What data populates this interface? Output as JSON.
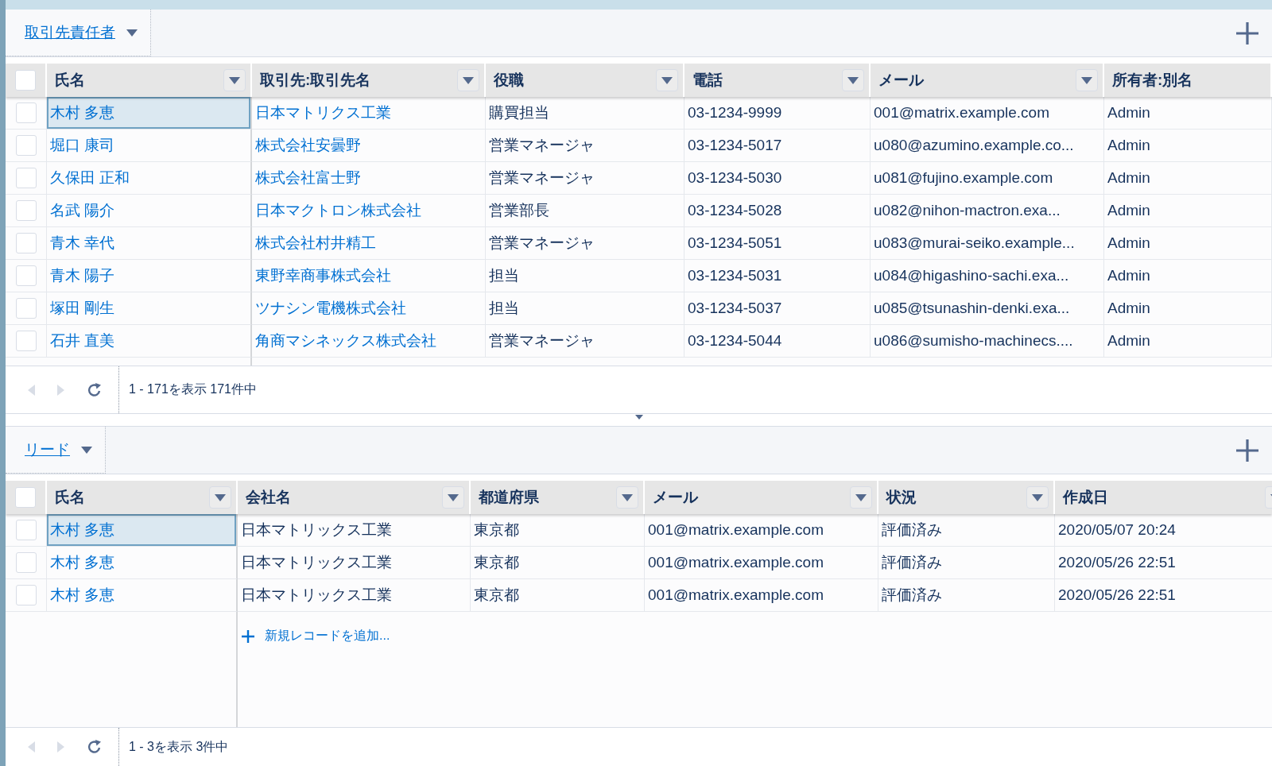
{
  "panels": [
    {
      "tab": {
        "label": "取引先責任者"
      },
      "header_checkbox": {
        "checked": false
      },
      "columns": [
        {
          "label": "氏名",
          "kind": "link",
          "menu": true
        },
        {
          "label": "取引先:取引先名",
          "kind": "link",
          "menu": true
        },
        {
          "label": "役職",
          "kind": "text",
          "menu": true
        },
        {
          "label": "電話",
          "kind": "text",
          "menu": true
        },
        {
          "label": "メール",
          "kind": "text",
          "menu": true
        },
        {
          "label": "所有者:別名",
          "kind": "text",
          "menu": false
        }
      ],
      "rows": [
        {
          "checked": false,
          "selected": true,
          "cells": [
            "木村 多恵",
            "日本マトリクス工業",
            "購買担当",
            "03-1234-9999",
            "001@matrix.example.com",
            "Admin"
          ]
        },
        {
          "checked": false,
          "selected": false,
          "cells": [
            "堀口 康司",
            "株式会社安曇野",
            "営業マネージャ",
            "03-1234-5017",
            "u080@azumino.example.co...",
            "Admin"
          ]
        },
        {
          "checked": false,
          "selected": false,
          "cells": [
            "久保田 正和",
            "株式会社富士野",
            "営業マネージャ",
            "03-1234-5030",
            "u081@fujino.example.com",
            "Admin"
          ]
        },
        {
          "checked": false,
          "selected": false,
          "cells": [
            "名武 陽介",
            "日本マクトロン株式会社",
            "営業部長",
            "03-1234-5028",
            "u082@nihon-mactron.exa...",
            "Admin"
          ]
        },
        {
          "checked": false,
          "selected": false,
          "cells": [
            "青木 幸代",
            "株式会社村井精工",
            "営業マネージャ",
            "03-1234-5051",
            "u083@murai-seiko.example...",
            "Admin"
          ]
        },
        {
          "checked": false,
          "selected": false,
          "cells": [
            "青木 陽子",
            "東野幸商事株式会社",
            "担当",
            "03-1234-5031",
            "u084@higashino-sachi.exa...",
            "Admin"
          ]
        },
        {
          "checked": false,
          "selected": false,
          "cells": [
            "塚田 剛生",
            "ツナシン電機株式会社",
            "担当",
            "03-1234-5037",
            "u085@tsunashin-denki.exa...",
            "Admin"
          ]
        },
        {
          "checked": false,
          "selected": false,
          "cells": [
            "石井 直美",
            "角商マシネックス株式会社",
            "営業マネージャ",
            "03-1234-5044",
            "u086@sumisho-machinecs....",
            "Admin"
          ]
        }
      ],
      "footer": {
        "summary": "1 - 171を表示 171件中"
      }
    },
    {
      "tab": {
        "label": "リード"
      },
      "header_checkbox": {
        "checked": false
      },
      "columns": [
        {
          "label": "氏名",
          "kind": "link",
          "menu": true
        },
        {
          "label": "会社名",
          "kind": "text",
          "menu": true
        },
        {
          "label": "都道府県",
          "kind": "text",
          "menu": true
        },
        {
          "label": "メール",
          "kind": "text",
          "menu": true
        },
        {
          "label": "状況",
          "kind": "text",
          "menu": true
        },
        {
          "label": "作成日",
          "kind": "text",
          "menu": true
        }
      ],
      "rows": [
        {
          "checked": false,
          "selected": true,
          "cells": [
            "木村 多恵",
            "日本マトリックス工業",
            "東京都",
            "001@matrix.example.com",
            "評価済み",
            "2020/05/07 20:24"
          ]
        },
        {
          "checked": false,
          "selected": false,
          "cells": [
            "木村 多恵",
            "日本マトリックス工業",
            "東京都",
            "001@matrix.example.com",
            "評価済み",
            "2020/05/26 22:51"
          ]
        },
        {
          "checked": false,
          "selected": false,
          "cells": [
            "木村 多恵",
            "日本マトリックス工業",
            "東京都",
            "001@matrix.example.com",
            "評価済み",
            "2020/05/26 22:51"
          ]
        }
      ],
      "add_record": "新規レコードを追加...",
      "footer": {
        "summary": "1 - 3を表示 3件中"
      }
    }
  ]
}
